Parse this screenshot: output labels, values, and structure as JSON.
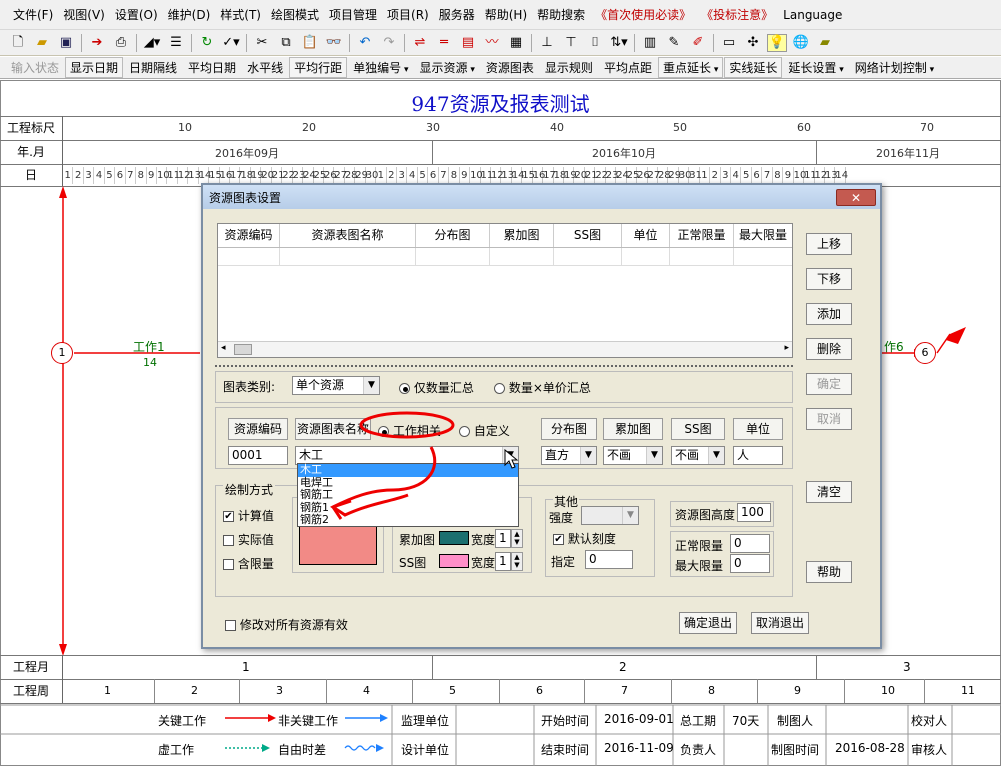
{
  "menubar": {
    "items": [
      "文件(F)",
      "视图(V)",
      "设置(O)",
      "维护(D)",
      "样式(T)",
      "绘图模式",
      "项目管理",
      "项目(R)",
      "服务器",
      "帮助(H)",
      "帮助搜索"
    ],
    "notices": [
      "《首次使用必读》",
      "《投标注意》"
    ],
    "language": "Language"
  },
  "toolbar2": {
    "items": [
      "输入状态",
      "显示日期",
      "日期隔线",
      "平均日期",
      "水平线",
      "平均行距",
      "单独编号",
      "显示资源",
      "资源图表",
      "显示规则",
      "平均点距",
      "重点延长",
      "实线延长",
      "延长设置",
      "网络计划控制"
    ]
  },
  "project": {
    "title": "947资源及报表测试"
  },
  "timescale": {
    "row_labels": [
      "工程标尺",
      "年.月",
      "日"
    ],
    "scale_numbers": [
      "10",
      "20",
      "30",
      "40",
      "50",
      "60",
      "70"
    ],
    "months": [
      "2016年09月",
      "2016年10月",
      "2016年11月"
    ],
    "days": [
      "1",
      "2",
      "3",
      "4",
      "5",
      "6",
      "7",
      "8",
      "9",
      "10",
      "11",
      "12",
      "13",
      "14",
      "15",
      "16",
      "17",
      "18",
      "19",
      "20",
      "21",
      "22",
      "23",
      "24",
      "25",
      "26",
      "27",
      "28",
      "29",
      "30",
      "1",
      "2",
      "3",
      "4",
      "5",
      "6",
      "7",
      "8",
      "9",
      "10",
      "11",
      "12",
      "13",
      "14",
      "15",
      "16",
      "17",
      "18",
      "19",
      "20",
      "21",
      "22",
      "23",
      "24",
      "25",
      "26",
      "27",
      "28",
      "29",
      "30",
      "31",
      "1",
      "2",
      "3",
      "4",
      "5",
      "6",
      "7",
      "8",
      "9",
      "10",
      "11",
      "12",
      "13",
      "14"
    ]
  },
  "gantt": {
    "node_start": "1",
    "node_end": "6",
    "work1_label": "工作1",
    "work1_duration": "14",
    "work6_label": "作6"
  },
  "bottom_scale": {
    "month_label": "工程月",
    "week_label": "工程周",
    "months": [
      "1",
      "2",
      "3"
    ],
    "weeks": [
      "1",
      "2",
      "3",
      "4",
      "5",
      "6",
      "7",
      "8",
      "9",
      "10",
      "11"
    ]
  },
  "legend": {
    "critical": "关键工作",
    "noncritical": "非关键工作",
    "virtual": "虚工作",
    "float": "自由时差"
  },
  "footer": {
    "supervisor": "监理单位",
    "designer": "设计单位",
    "start_label": "开始时间",
    "start_value": "2016-09-01",
    "end_label": "结束时间",
    "end_value": "2016-11-09",
    "duration_label": "总工期",
    "duration_value": "70天",
    "manager_label": "负责人",
    "drawer_label": "制图人",
    "drawtime_label": "制图时间",
    "drawtime_value": "2016-08-28",
    "checker_label": "校对人",
    "reviewer_label": "审核人"
  },
  "dialog": {
    "title": "资源图表设置",
    "close_label": "✕",
    "table_headers": [
      "资源编码",
      "资源表图名称",
      "分布图",
      "累加图",
      "SS图",
      "单位",
      "正常限量",
      "最大限量"
    ],
    "side_buttons": {
      "up": "上移",
      "down": "下移",
      "add": "添加",
      "delete": "删除",
      "confirm": "确定",
      "cancel": "取消",
      "clear": "清空",
      "help": "帮助"
    },
    "chart_category_label": "图表类别:",
    "chart_category_value": "单个资源",
    "sum_qty_label": "仅数量汇总",
    "sum_price_label": "数量×单价汇总",
    "code_header": "资源编码",
    "name_header": "资源图表名称",
    "work_related_label": "工作相关",
    "custom_label": "自定义",
    "dist_header": "分布图",
    "accum_header": "累加图",
    "ss_header": "SS图",
    "unit_header": "单位",
    "code_value": "0001",
    "name_value": "木工",
    "dist_value": "直方",
    "accum_value": "不画",
    "ss_value": "不画",
    "unit_value": "人",
    "dropdown_options": [
      "木工",
      "电焊工",
      "钢筋工",
      "钢筋1",
      "钢筋2"
    ],
    "draw_method_label": "绘制方式",
    "calc_label": "计算值",
    "actual_label": "实际值",
    "limit_label": "含限量",
    "accum_chart_label": "累加图",
    "ss_chart_label": "SS图",
    "width_label": "宽度",
    "width1": "1",
    "width2": "1",
    "other_label": "其他",
    "intensity_label": "强度",
    "default_scale_label": "默认刻度",
    "specify_label": "指定",
    "specify_value": "0",
    "height_label": "资源图高度",
    "height_value": "100",
    "normal_limit_label": "正常限量",
    "normal_limit_value": "0",
    "max_limit_label": "最大限量",
    "max_limit_value": "0",
    "apply_all_label": "修改对所有资源有效",
    "ok_label": "确定退出",
    "cancel_label": "取消退出"
  }
}
